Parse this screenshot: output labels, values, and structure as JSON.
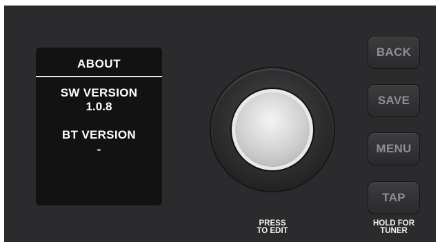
{
  "screen": {
    "title": "ABOUT",
    "sw_label": "SW VERSION",
    "sw_value": "1.0.8",
    "bt_label": "BT VERSION",
    "bt_value": "-"
  },
  "knob": {
    "caption_line1": "PRESS",
    "caption_line2": "TO EDIT"
  },
  "buttons": {
    "back": "BACK",
    "save": "SAVE",
    "menu": "MENU",
    "tap": "TAP"
  },
  "tap_caption": {
    "line1": "HOLD FOR",
    "line2": "TUNER"
  },
  "colors": {
    "panel": "#2b2b2d",
    "screen": "#121212",
    "button_text": "#8f8f92",
    "caption_text": "#f2f2f2"
  }
}
